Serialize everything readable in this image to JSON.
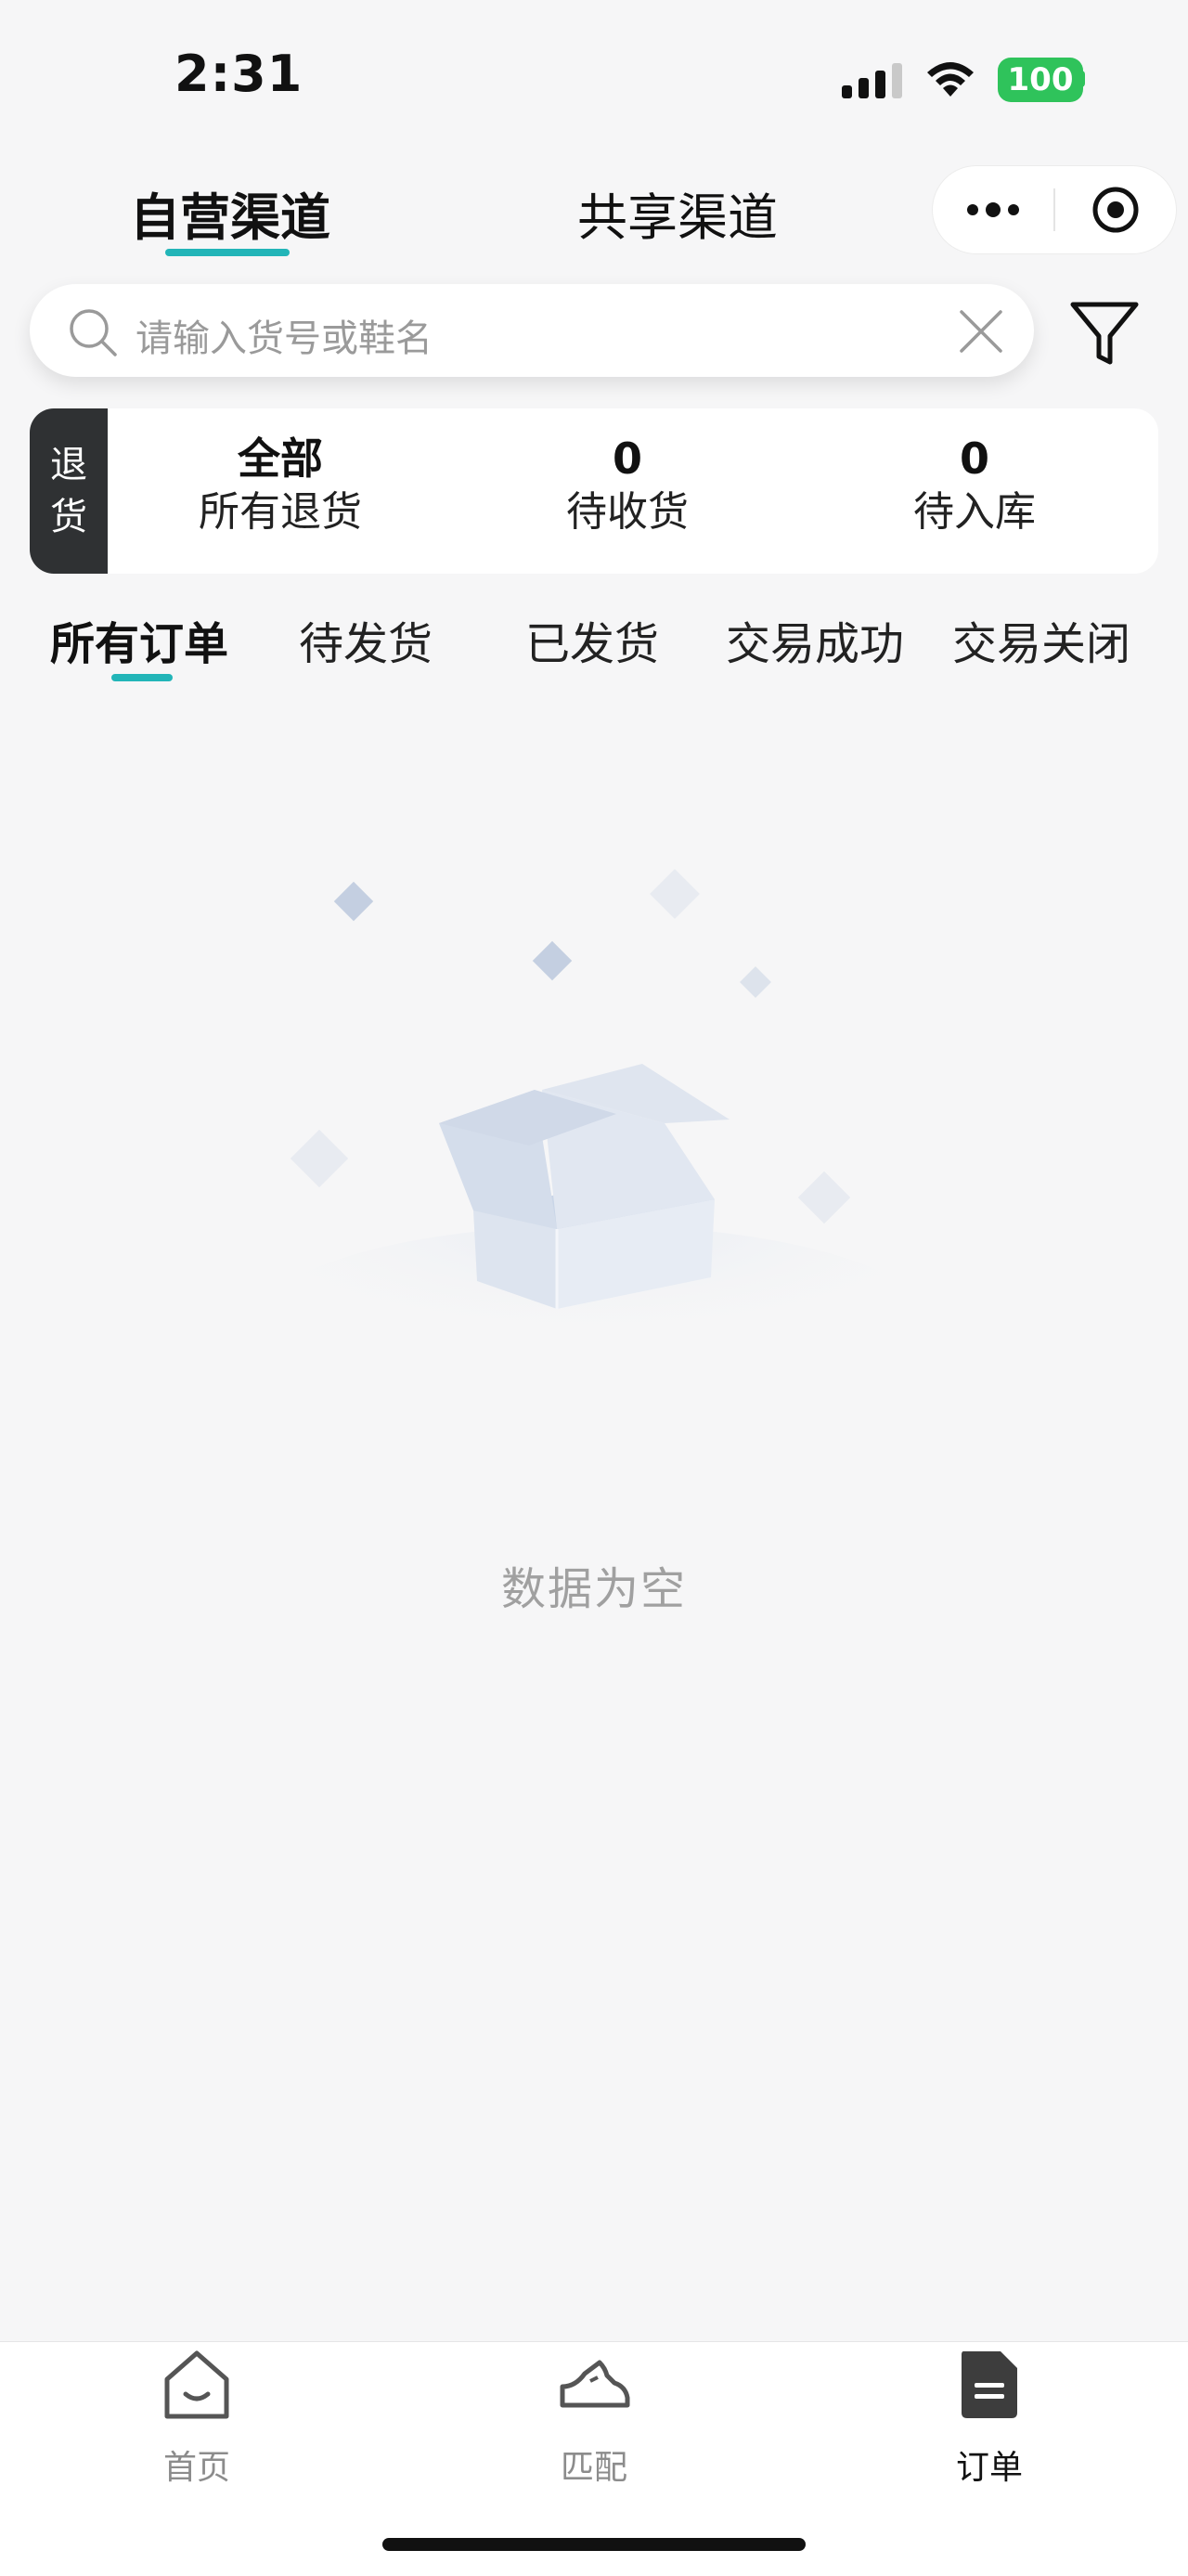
{
  "status_bar": {
    "time": "2:31",
    "battery": "100"
  },
  "channel_tabs": [
    {
      "label": "自营渠道",
      "active": true
    },
    {
      "label": "共享渠道",
      "active": false
    }
  ],
  "search": {
    "placeholder": "请输入货号或鞋名"
  },
  "returns": {
    "side_label_1": "退",
    "side_label_2": "货",
    "stats": [
      {
        "value": "全部",
        "label": "所有退货"
      },
      {
        "value": "0",
        "label": "待收货"
      },
      {
        "value": "0",
        "label": "待入库"
      }
    ]
  },
  "order_tabs": [
    {
      "label": "所有订单",
      "active": true
    },
    {
      "label": "待发货",
      "active": false
    },
    {
      "label": "已发货",
      "active": false
    },
    {
      "label": "交易成功",
      "active": false
    },
    {
      "label": "交易关闭",
      "active": false
    }
  ],
  "empty_state": {
    "message": "数据为空"
  },
  "bottom_nav": [
    {
      "label": "首页",
      "icon": "home-icon",
      "active": false
    },
    {
      "label": "匹配",
      "icon": "sneaker-icon",
      "active": false
    },
    {
      "label": "订单",
      "icon": "order-icon",
      "active": true
    }
  ],
  "colors": {
    "accent": "#22b5b8",
    "battery": "#2fc35b",
    "return_side": "#2f3133"
  }
}
